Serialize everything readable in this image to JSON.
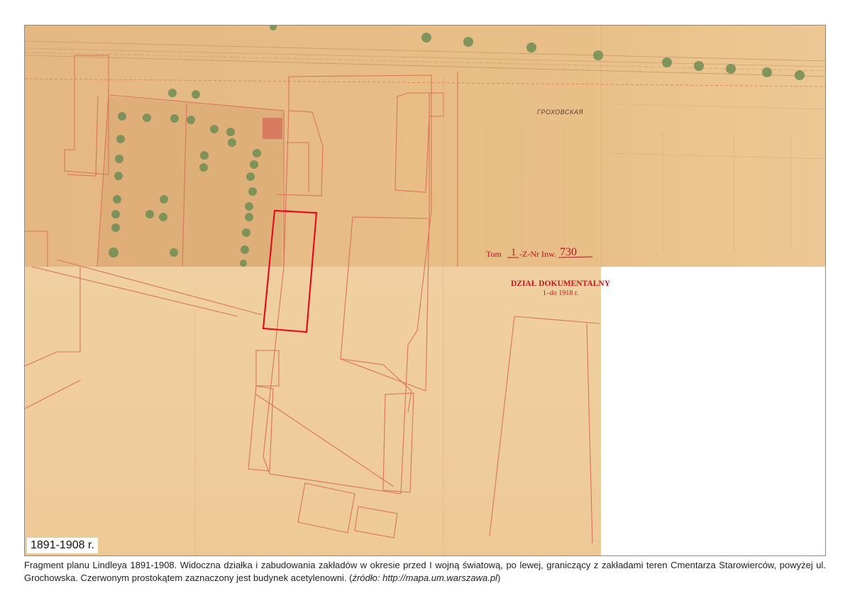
{
  "map": {
    "street_label": "ГРОХОВСКАЯ",
    "archive_ref": {
      "tom_label": "Tom",
      "tom_number": "1",
      "znr_label": "-Z-Nr Inw.",
      "inventory_number": "730"
    },
    "stamp": {
      "line1": "DZIAŁ DOKUMENTALNY",
      "line2": "1–do 1918 r."
    },
    "colors": {
      "paper_upper": "#e8bd85",
      "paper_lower": "#f0d2a2",
      "plan_lines": "#d9735a",
      "highlight": "#e0101e",
      "tree": "#6f8d55"
    }
  },
  "date_label": "1891-1908 r.",
  "caption": {
    "text": "Fragment planu Lindleya 1891-1908. Widoczna działka i zabudowania zakładów w okresie przed I wojną światową, po lewej, graniczący z zakładami teren Cmentarza Starowierców, powyżej ul. Grochowska. Czerwonym prostokątem zaznaczony jest budynek acetylenowni.",
    "source_open": "(",
    "source_label": "źródło: http://mapa.um.warszawa.pl",
    "source_close": ")"
  }
}
